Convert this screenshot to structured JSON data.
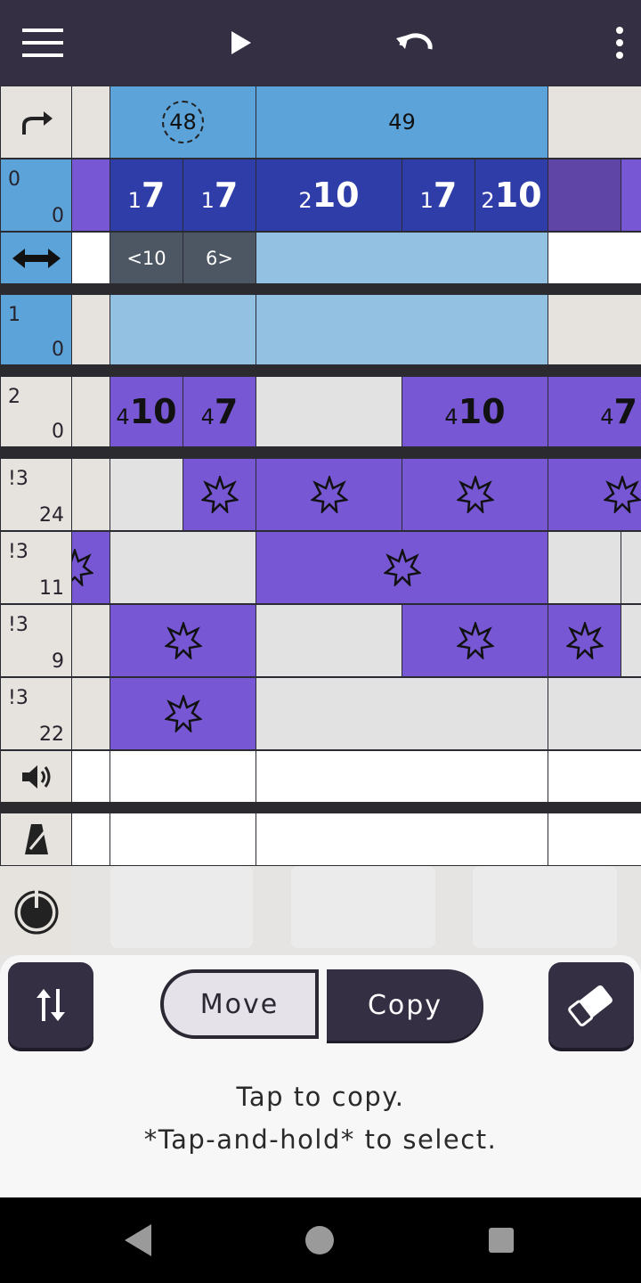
{
  "toolbar": {
    "menu_icon": "hamburger-menu-icon",
    "play_icon": "play-icon",
    "undo_icon": "undo-icon",
    "more_icon": "more-vertical-icon"
  },
  "beats": {
    "marker_current": "48",
    "marker_next": "49"
  },
  "rows": {
    "row0": {
      "a": "0",
      "b": "0"
    },
    "row1": {
      "a": "1",
      "b": "0"
    },
    "row2": {
      "a": "2",
      "b": "0"
    },
    "pct1": {
      "a": "!3",
      "b": "24"
    },
    "pct2": {
      "a": "!3",
      "b": "11"
    },
    "pct3": {
      "a": "!3",
      "b": "9"
    },
    "pct4": {
      "a": "!3",
      "b": "22"
    }
  },
  "notes_row0": [
    {
      "sub": "1",
      "main": "7"
    },
    {
      "sub": "1",
      "main": "7"
    },
    {
      "sub": "2",
      "main": "10"
    },
    {
      "sub": "1",
      "main": "7"
    },
    {
      "sub": "2",
      "main": "10"
    }
  ],
  "tuplet": {
    "left": "<10",
    "right": "6>"
  },
  "notes_row2": [
    {
      "sub": "4",
      "main": "10"
    },
    {
      "sub": "4",
      "main": "7"
    },
    {
      "sub": "4",
      "main": "10"
    },
    {
      "sub": "4",
      "main": "7"
    }
  ],
  "panel": {
    "move_label": "Move",
    "copy_label": "Copy",
    "hint_line1": "Tap to copy.",
    "hint_line2": "*Tap-and-hold* to select."
  },
  "colors": {
    "toolbar": "#352f44",
    "row_header_blue": "#5ba3d8",
    "note_dark_blue": "#2e3da8",
    "percussion_purple": "#7757d4"
  }
}
